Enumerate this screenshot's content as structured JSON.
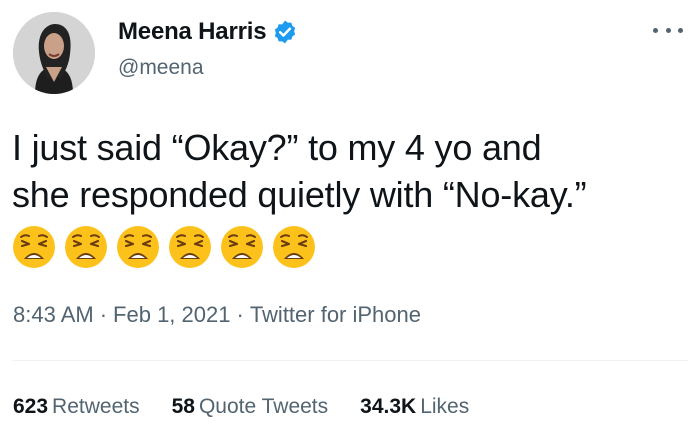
{
  "author": {
    "display_name": "Meena Harris",
    "handle": "@meena",
    "verified": true,
    "avatar_icon": "profile-photo"
  },
  "menu_icon": "more-dots-icon",
  "tweet": {
    "text_line1": "I just said “Okay?” to my 4 yo and",
    "text_line2": "she responded quietly with “No-kay.”",
    "emojis": [
      "weary-face",
      "weary-face",
      "weary-face",
      "weary-face",
      "weary-face",
      "weary-face"
    ]
  },
  "meta": {
    "time": "8:43 AM",
    "sep": "·",
    "date": "Feb 1, 2021",
    "source": "Twitter for iPhone"
  },
  "stats": {
    "retweets_count": "623",
    "retweets_label": "Retweets",
    "quotes_count": "58",
    "quotes_label": "Quote Tweets",
    "likes_count": "34.3K",
    "likes_label": "Likes"
  },
  "colors": {
    "text": "#0f1419",
    "secondary": "#536471",
    "verified_blue": "#1d9bf0",
    "emoji_yellow": "#fcc21b"
  }
}
